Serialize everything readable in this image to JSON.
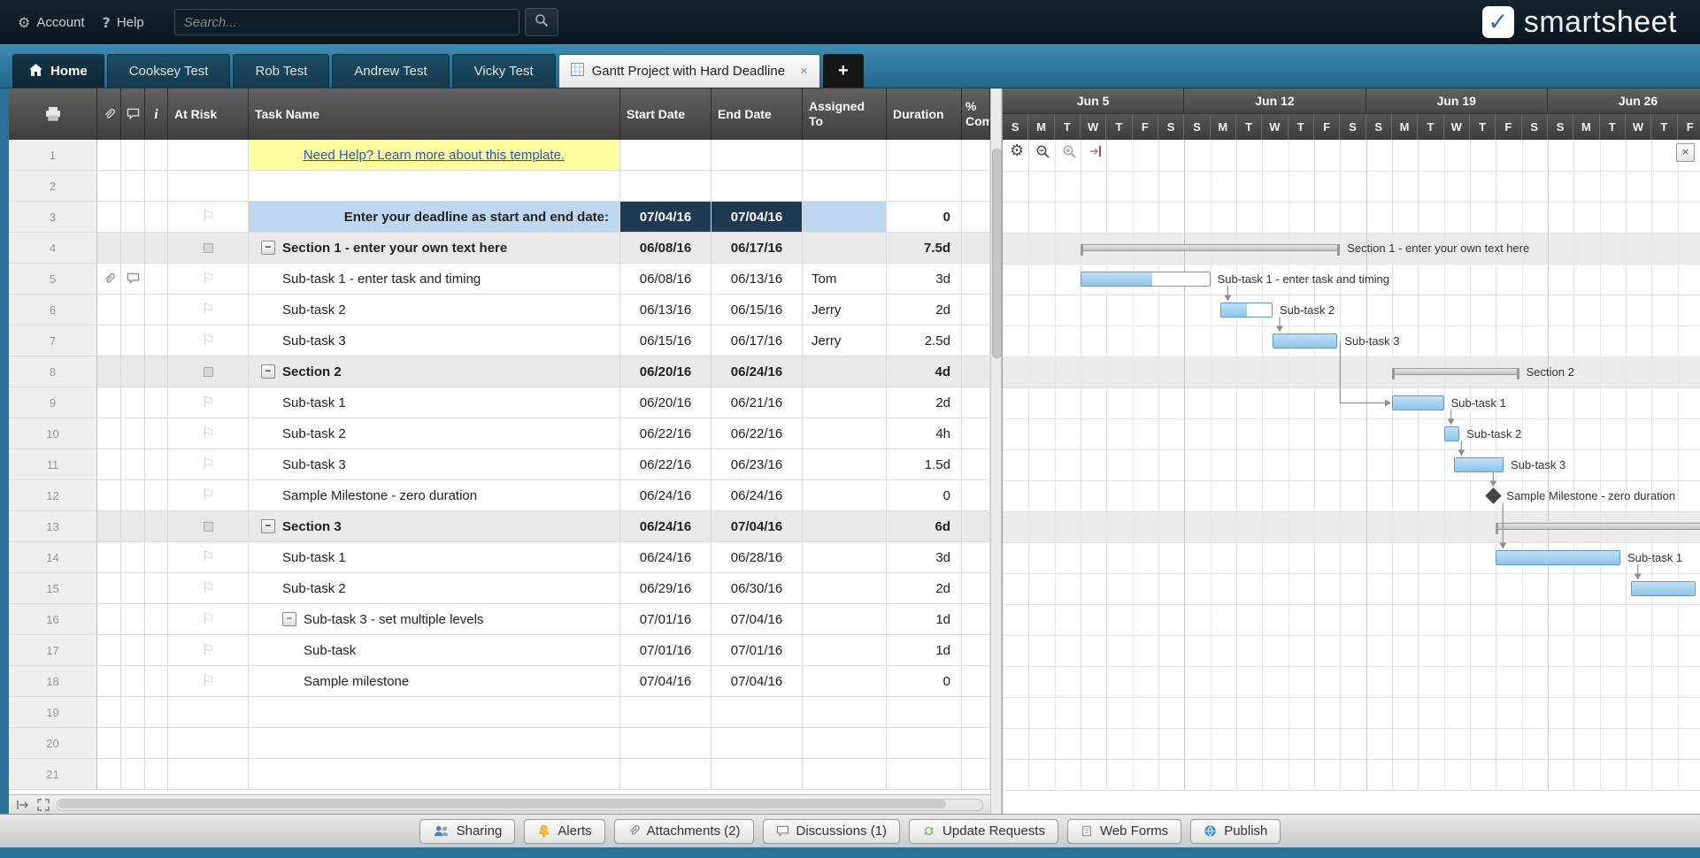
{
  "brand": {
    "check": "✓",
    "part1": "smart",
    "part2": "sheet"
  },
  "topbar": {
    "account_label": "Account",
    "help_label": "Help",
    "help_glyph": "?",
    "search_placeholder": "Search..."
  },
  "tabs": {
    "home_label": "Home",
    "items": [
      {
        "label": "Cooksey Test"
      },
      {
        "label": "Rob Test"
      },
      {
        "label": "Andrew Test"
      },
      {
        "label": "Vicky Test"
      }
    ],
    "active": {
      "label": "Gantt Project with Hard Deadline",
      "close": "×"
    },
    "add_label": "+"
  },
  "grid": {
    "header": {
      "at_risk": "At Risk",
      "task_name": "Task Name",
      "start": "Start Date",
      "end": "End Date",
      "assigned": "Assigned To",
      "duration": "Duration",
      "pct": "% Complete",
      "info_glyph": "i"
    },
    "rows": [
      {
        "num": 1,
        "kind": "note",
        "task": "Need Help? Learn more about this template."
      },
      {
        "num": 2
      },
      {
        "num": 3,
        "kind": "deadline",
        "flag": true,
        "task": "Enter your deadline as start and end date:",
        "start": "07/04/16",
        "end": "07/04/16",
        "duration": "0"
      },
      {
        "num": 4,
        "kind": "section",
        "collapse": true,
        "indent": 0,
        "task": "Section 1 - enter your own text here",
        "start": "06/08/16",
        "end": "06/17/16",
        "duration": "7.5d"
      },
      {
        "num": 5,
        "kind": "task",
        "indent": 1,
        "flag": true,
        "attach": true,
        "comment": true,
        "task": "Sub-task 1 - enter task and timing",
        "start": "06/08/16",
        "end": "06/13/16",
        "assigned": "Tom",
        "duration": "3d"
      },
      {
        "num": 6,
        "kind": "task",
        "indent": 1,
        "flag": true,
        "task": "Sub-task 2",
        "start": "06/13/16",
        "end": "06/15/16",
        "assigned": "Jerry",
        "duration": "2d"
      },
      {
        "num": 7,
        "kind": "task",
        "indent": 1,
        "flag": true,
        "task": "Sub-task 3",
        "start": "06/15/16",
        "end": "06/17/16",
        "assigned": "Jerry",
        "duration": "2.5d"
      },
      {
        "num": 8,
        "kind": "section",
        "collapse": true,
        "indent": 0,
        "task": "Section 2",
        "start": "06/20/16",
        "end": "06/24/16",
        "duration": "4d"
      },
      {
        "num": 9,
        "kind": "task",
        "indent": 1,
        "flag": true,
        "task": "Sub-task 1",
        "start": "06/20/16",
        "end": "06/21/16",
        "duration": "2d"
      },
      {
        "num": 10,
        "kind": "task",
        "indent": 1,
        "flag": true,
        "task": "Sub-task 2",
        "start": "06/22/16",
        "end": "06/22/16",
        "duration": "4h"
      },
      {
        "num": 11,
        "kind": "task",
        "indent": 1,
        "flag": true,
        "task": "Sub-task 3",
        "start": "06/22/16",
        "end": "06/23/16",
        "duration": "1.5d"
      },
      {
        "num": 12,
        "kind": "task",
        "indent": 1,
        "flag": true,
        "task": "Sample Milestone - zero duration",
        "start": "06/24/16",
        "end": "06/24/16",
        "duration": "0"
      },
      {
        "num": 13,
        "kind": "section",
        "collapse": true,
        "indent": 0,
        "task": "Section 3",
        "start": "06/24/16",
        "end": "07/04/16",
        "duration": "6d"
      },
      {
        "num": 14,
        "kind": "task",
        "indent": 1,
        "flag": true,
        "task": "Sub-task 1",
        "start": "06/24/16",
        "end": "06/28/16",
        "duration": "3d"
      },
      {
        "num": 15,
        "kind": "task",
        "indent": 1,
        "flag": true,
        "task": "Sub-task 2",
        "start": "06/29/16",
        "end": "06/30/16",
        "duration": "2d"
      },
      {
        "num": 16,
        "kind": "task",
        "indent": 1,
        "collapse": true,
        "flag": true,
        "task": "Sub-task 3 - set multiple levels",
        "start": "07/01/16",
        "end": "07/04/16",
        "duration": "1d"
      },
      {
        "num": 17,
        "kind": "task",
        "indent": 2,
        "flag": true,
        "task": "Sub-task",
        "start": "07/01/16",
        "end": "07/01/16",
        "duration": "1d"
      },
      {
        "num": 18,
        "kind": "task",
        "indent": 2,
        "flag": true,
        "task": "Sample milestone",
        "start": "07/04/16",
        "end": "07/04/16",
        "duration": "0"
      },
      {
        "num": 19
      },
      {
        "num": 20
      },
      {
        "num": 21
      }
    ]
  },
  "gantt": {
    "close_label": "×",
    "weeks": [
      "Jun 5",
      "Jun 12",
      "Jun 19",
      "Jun 26"
    ],
    "day_letters": [
      "S",
      "M",
      "T",
      "W",
      "T",
      "F",
      "S"
    ],
    "bars": [
      {
        "id": "r4",
        "row": 4,
        "type": "summary",
        "start": 3,
        "days": 10,
        "label": "Section 1 - enter your own text here"
      },
      {
        "id": "r5",
        "row": 5,
        "type": "task",
        "start": 3,
        "days": 5,
        "progress": 55,
        "label": "Sub-task 1 - enter task and timing"
      },
      {
        "id": "r6",
        "row": 6,
        "type": "task",
        "start": 8.4,
        "days": 2,
        "progress": 50,
        "label": "Sub-task 2"
      },
      {
        "id": "r7",
        "row": 7,
        "type": "task",
        "start": 10.4,
        "days": 2.5,
        "progress": 100,
        "label": "Sub-task 3"
      },
      {
        "id": "r8",
        "row": 8,
        "type": "summary",
        "start": 15,
        "days": 4.9,
        "label": "Section 2"
      },
      {
        "id": "r9",
        "row": 9,
        "type": "task",
        "start": 15,
        "days": 2,
        "progress": 100,
        "label": "Sub-task 1"
      },
      {
        "id": "r10",
        "row": 10,
        "type": "task",
        "start": 17,
        "days": 0.6,
        "progress": 100,
        "label": "Sub-task 2"
      },
      {
        "id": "r11",
        "row": 11,
        "type": "task",
        "start": 17.4,
        "days": 1.9,
        "progress": 100,
        "label": "Sub-task 3"
      },
      {
        "id": "r12",
        "row": 12,
        "type": "milestone",
        "start": 18.9,
        "label": "Sample Milestone - zero duration"
      },
      {
        "id": "r13",
        "row": 13,
        "type": "summary",
        "start": 19,
        "days": 12,
        "label": ""
      },
      {
        "id": "r14",
        "row": 14,
        "type": "task",
        "start": 19,
        "days": 4.8,
        "progress": 100,
        "label": "Sub-task 1"
      },
      {
        "id": "r15",
        "row": 15,
        "type": "task",
        "start": 24.2,
        "days": 2.5,
        "progress": 100,
        "label": ""
      }
    ],
    "connectors": [
      [
        "r5",
        "r6"
      ],
      [
        "r6",
        "r7"
      ],
      [
        "r7",
        "r9"
      ],
      [
        "r9",
        "r10"
      ],
      [
        "r10",
        "r11"
      ],
      [
        "r11",
        "r12"
      ],
      [
        "r12",
        "r14"
      ],
      [
        "r14",
        "r15"
      ]
    ]
  },
  "bottombar": {
    "buttons": [
      {
        "icon": "people",
        "label": "Sharing"
      },
      {
        "icon": "bell",
        "label": "Alerts"
      },
      {
        "icon": "paperclip",
        "label": "Attachments (2)"
      },
      {
        "icon": "bubble",
        "label": "Discussions (1)"
      },
      {
        "icon": "update",
        "label": "Update Requests"
      },
      {
        "icon": "form",
        "label": "Web Forms"
      },
      {
        "icon": "globe",
        "label": "Publish"
      }
    ]
  }
}
